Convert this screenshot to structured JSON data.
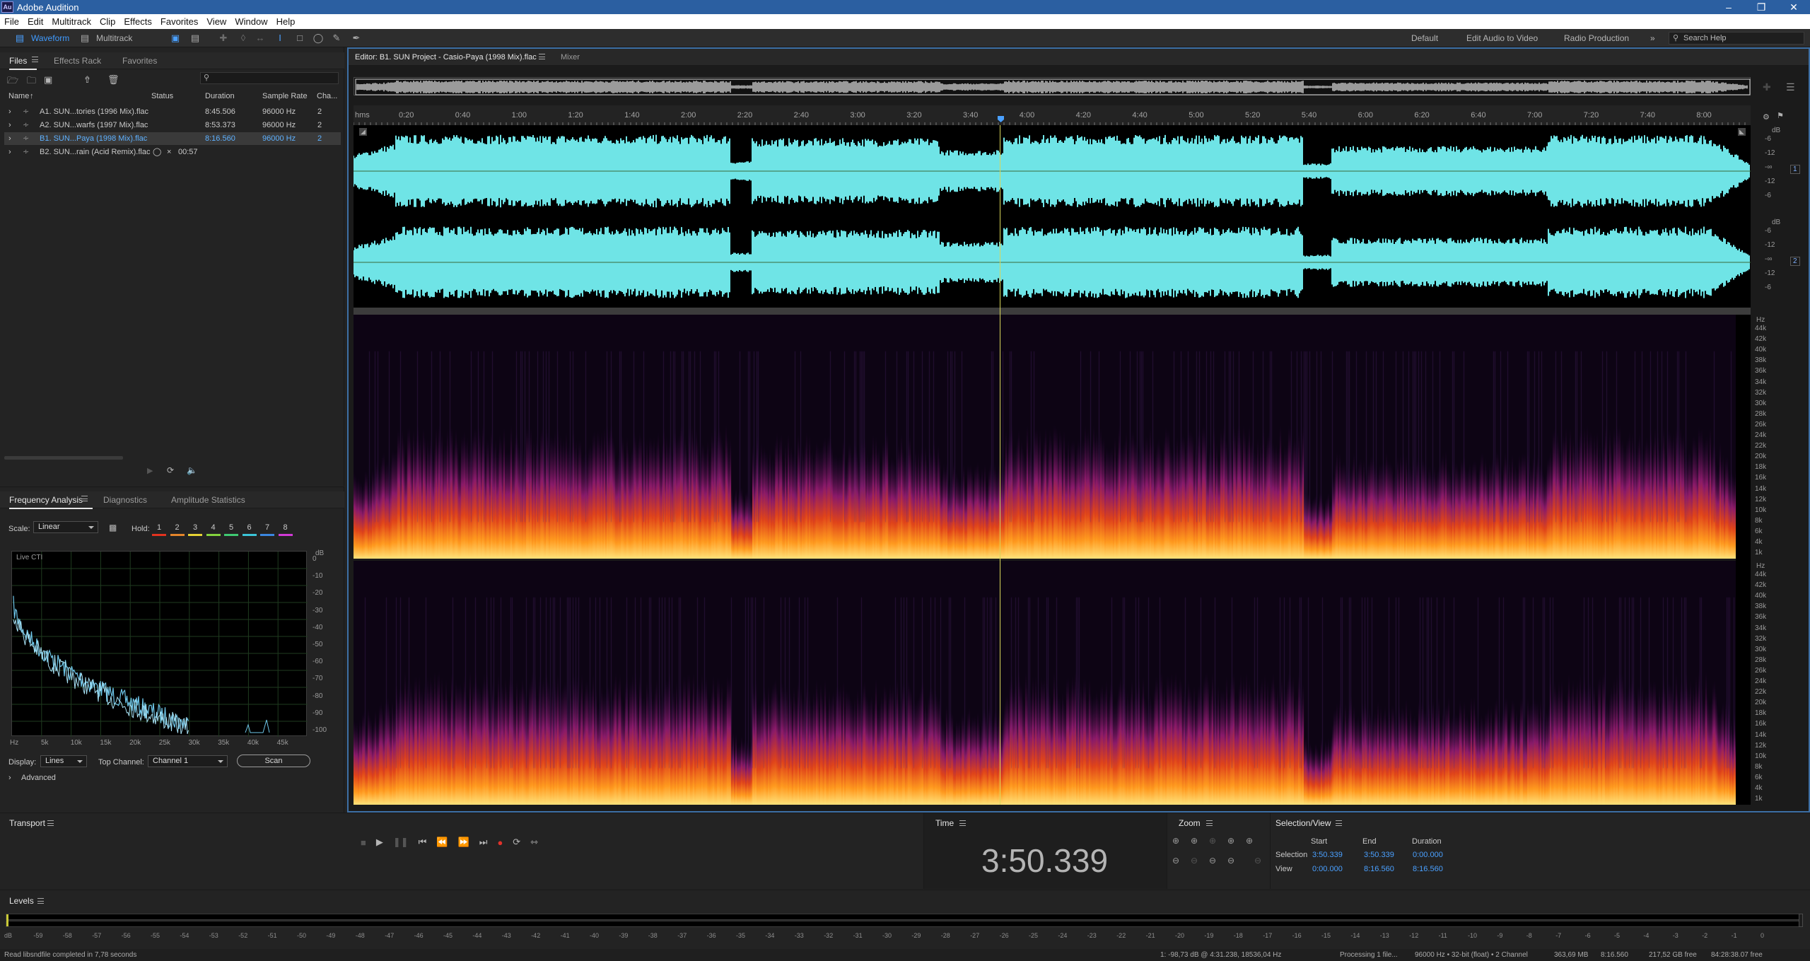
{
  "app": {
    "title": "Adobe Audition",
    "logo": "Au"
  },
  "menu": [
    "File",
    "Edit",
    "Multitrack",
    "Clip",
    "Effects",
    "Favorites",
    "View",
    "Window",
    "Help"
  ],
  "toolbar": {
    "waveform_label": "Waveform",
    "multitrack_label": "Multitrack",
    "workspaces": [
      "Default",
      "Edit Audio to Video",
      "Radio Production"
    ],
    "search_placeholder": "Search Help"
  },
  "files_panel": {
    "tabs": [
      "Files",
      "Effects Rack",
      "Favorites"
    ],
    "columns": [
      "Name",
      "Status",
      "Duration",
      "Sample Rate",
      "Cha..."
    ],
    "rows": [
      {
        "name": "A1. SUN...tories (1996 Mix).flac",
        "status": "",
        "duration": "8:45.506",
        "rate": "96000 Hz",
        "ch": "2",
        "selected": false
      },
      {
        "name": "A2. SUN...warfs (1997 Mix).flac",
        "status": "",
        "duration": "8:53.373",
        "rate": "96000 Hz",
        "ch": "2",
        "selected": false
      },
      {
        "name": "B1. SUN...Paya (1998 Mix).flac",
        "status": "",
        "duration": "8:16.560",
        "rate": "96000 Hz",
        "ch": "2",
        "selected": true
      },
      {
        "name": "B2. SUN...rain (Acid Remix).flac",
        "status": "00:57",
        "duration": "",
        "rate": "",
        "ch": "",
        "selected": false
      }
    ]
  },
  "freq_panel": {
    "tabs": [
      "Frequency Analysis",
      "Diagnostics",
      "Amplitude Statistics"
    ],
    "scale_label": "Scale:",
    "scale_value": "Linear",
    "hold_label": "Hold:",
    "hold_slots": [
      "1",
      "2",
      "3",
      "4",
      "5",
      "6",
      "7",
      "8"
    ],
    "hold_colors": [
      "#e3331f",
      "#e5852b",
      "#e6d334",
      "#83d33e",
      "#3fc972",
      "#3bc4d8",
      "#3b86e0",
      "#d13ad6"
    ],
    "live_label": "Live CTI",
    "db_labels": [
      "dB",
      "0",
      "-10",
      "-20",
      "-30",
      "-40",
      "-50",
      "-60",
      "-70",
      "-80",
      "-90",
      "-100"
    ],
    "hz_labels": [
      "Hz",
      "5k",
      "10k",
      "15k",
      "20k",
      "25k",
      "30k",
      "35k",
      "40k",
      "45k"
    ],
    "display_label": "Display:",
    "display_value": "Lines",
    "top_channel_label": "Top Channel:",
    "top_channel_value": "Channel 1",
    "scan_label": "Scan",
    "advanced_label": "Advanced"
  },
  "editor": {
    "tab_label": "Editor: B1. SUN Project - Casio-Paya (1998 Mix).flac",
    "mixer_label": "Mixer",
    "ruler_unit": "hms",
    "ruler_ticks": [
      "0:20",
      "0:40",
      "1:00",
      "1:20",
      "1:40",
      "2:00",
      "2:20",
      "2:40",
      "3:00",
      "3:20",
      "3:40",
      "4:00",
      "4:20",
      "4:40",
      "5:00",
      "5:20",
      "5:40",
      "6:00",
      "6:20",
      "6:40",
      "7:00",
      "7:20",
      "7:40",
      "8:00"
    ],
    "wave_db_labels": [
      "dB",
      "-6",
      "-12",
      "-∞",
      "-12",
      "-6"
    ],
    "channel_labels": [
      "1",
      "2"
    ],
    "spec_hz_labels": [
      "Hz",
      "44k",
      "42k",
      "40k",
      "38k",
      "36k",
      "34k",
      "32k",
      "30k",
      "28k",
      "26k",
      "24k",
      "22k",
      "20k",
      "18k",
      "16k",
      "14k",
      "12k",
      "10k",
      "8k",
      "6k",
      "4k",
      "1k"
    ],
    "waveform_color": "#6fe4e6"
  },
  "transport": {
    "title": "Transport"
  },
  "time": {
    "title": "Time",
    "value": "3:50.339"
  },
  "zoom": {
    "title": "Zoom"
  },
  "selection_view": {
    "title": "Selection/View",
    "headers": [
      "Start",
      "End",
      "Duration"
    ],
    "selection_label": "Selection",
    "view_label": "View",
    "selection": [
      "3:50.339",
      "3:50.339",
      "0:00.000"
    ],
    "view": [
      "0:00.000",
      "8:16.560",
      "8:16.560"
    ]
  },
  "levels": {
    "title": "Levels",
    "ticks": [
      "dB",
      "-59",
      "-58",
      "-57",
      "-56",
      "-55",
      "-54",
      "-53",
      "-52",
      "-51",
      "-50",
      "-49",
      "-48",
      "-47",
      "-46",
      "-45",
      "-44",
      "-43",
      "-42",
      "-41",
      "-40",
      "-39",
      "-38",
      "-37",
      "-36",
      "-35",
      "-34",
      "-33",
      "-32",
      "-31",
      "-30",
      "-29",
      "-28",
      "-27",
      "-26",
      "-25",
      "-24",
      "-23",
      "-22",
      "-21",
      "-20",
      "-19",
      "-18",
      "-17",
      "-16",
      "-15",
      "-14",
      "-13",
      "-12",
      "-11",
      "-10",
      "-9",
      "-8",
      "-7",
      "-6",
      "-5",
      "-4",
      "-3",
      "-2",
      "-1",
      "0"
    ]
  },
  "status": {
    "left": "Read libsndfile completed in 7,78 seconds",
    "cursor": "1: -98,73 dB @ 4:31.238, 18536,04 Hz",
    "processing": "Processing 1 file...",
    "format": "96000 Hz • 32-bit (float) • 2 Channel",
    "size": "363,69 MB",
    "duration": "8:16.560",
    "free": "217,52 GB free",
    "remaining": "84:28:38.07 free"
  }
}
